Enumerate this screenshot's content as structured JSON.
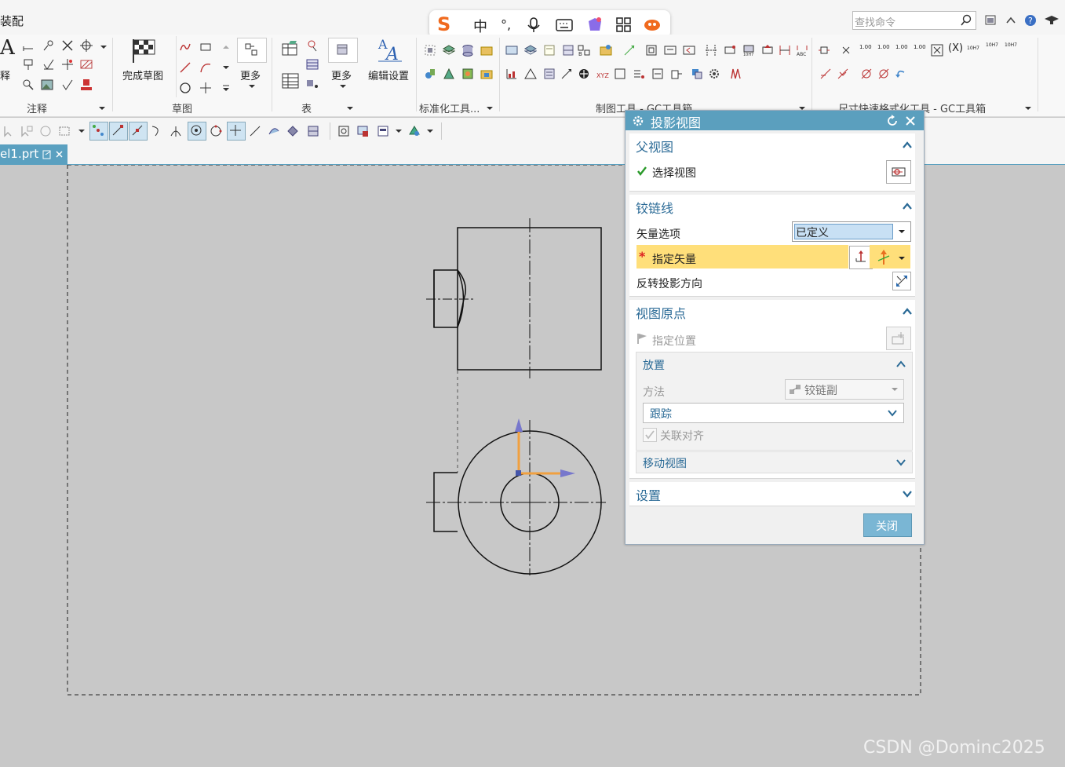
{
  "window": {
    "menu_left": "装配",
    "search_placeholder": "查找命令",
    "tab_file": "el1.prt"
  },
  "ime_bar": {
    "logo": "S",
    "lang": "中",
    "punct": "°,"
  },
  "ribbon": {
    "groups": {
      "annotation": "注释",
      "sketch": "草图",
      "table": "表",
      "standard_tools": "标准化工具...",
      "drafting_tools": "制图工具 - GC工具箱",
      "dimension_tools": "尺寸快速格式化工具 - GC工具箱"
    },
    "annotation_partial": "释",
    "finish_sketch": "完成草图",
    "more_sketch": "更多",
    "more_table": "更多",
    "edit_settings": "编辑设置",
    "tol_values": [
      "1.00",
      "1.00",
      "1.00",
      "1.00"
    ],
    "fit_labels": [
      "10H7",
      "10H7",
      "10H7"
    ]
  },
  "dialog": {
    "title": "投影视图",
    "parent_view": {
      "title": "父视图",
      "select_view": "选择视图"
    },
    "hinge_line": {
      "title": "铰链线",
      "vector_option_label": "矢量选项",
      "vector_option_value": "已定义",
      "specify_vector": "指定矢量",
      "reverse_direction": "反转投影方向"
    },
    "view_origin": {
      "title": "视图原点",
      "specify_position": "指定位置",
      "placement": {
        "title": "放置",
        "method_label": "方法",
        "method_value": "铰链副",
        "tracking_value": "跟踪",
        "associative_align": "关联对齐"
      },
      "move_view": "移动视图"
    },
    "settings": {
      "title": "设置"
    },
    "close_button": "关闭"
  },
  "watermark": "CSDN @Dominc2025",
  "colors": {
    "dialog_title_bg": "#5b9fbe",
    "section_title": "#2a6a96",
    "highlight_row": "#ffdf7a",
    "close_button": "#7ab6d4",
    "canvas_bg": "#c8c8c8"
  }
}
